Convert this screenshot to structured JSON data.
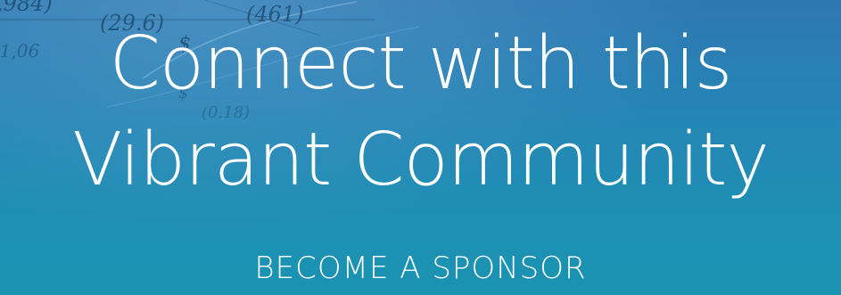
{
  "background": {
    "figures": [
      "(29.6)",
      "(461)",
      "(1,06",
      "(0.18)",
      "$",
      "$",
      ",984)"
    ],
    "colors": {
      "base": "#1f86b3",
      "top": "#2f78b2",
      "bottom": "#1b93b3",
      "figure_ink": "#0d2a4a"
    }
  },
  "hero": {
    "headline_line1": "Connect with this",
    "headline_line2": "Vibrant Community",
    "cta_label": "BECOME A SPONSOR"
  }
}
